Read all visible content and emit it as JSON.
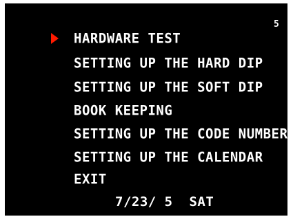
{
  "screen": {
    "page_number": "5",
    "selected_index": 0,
    "cursor_color": "#ff1a00",
    "cursor_icon": "red-triangle-pointer",
    "menu": {
      "items": [
        {
          "label": "HARDWARE TEST"
        },
        {
          "label": "SETTING UP THE HARD DIP"
        },
        {
          "label": "SETTING UP THE SOFT DIP"
        },
        {
          "label": "BOOK KEEPING"
        },
        {
          "label": "SETTING UP THE CODE NUMBER"
        },
        {
          "label": "SETTING UP THE CALENDAR"
        },
        {
          "label": "EXIT"
        }
      ]
    },
    "date": "7/23/ 5",
    "weekday": "SAT"
  }
}
